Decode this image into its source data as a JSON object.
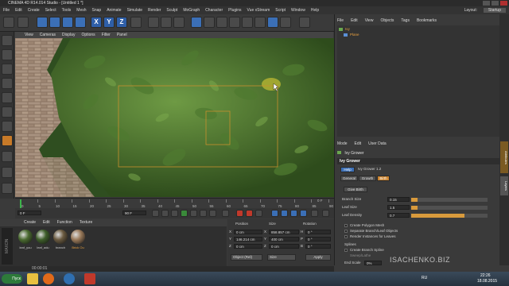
{
  "titlebar": {
    "title": "CINEMA 4D R14.014 Studio - [Untitled 1 *]"
  },
  "menubar": {
    "items": [
      "File",
      "Edit",
      "Create",
      "Select",
      "Tools",
      "Mesh",
      "Snap",
      "Animate",
      "Simulate",
      "Render",
      "Sculpt",
      "MoGraph",
      "Character",
      "Plugins",
      "Vue xStream",
      "Script",
      "Window",
      "Help"
    ],
    "layout_label": "Layout:",
    "layout_value": "Startup"
  },
  "toolbar": {
    "axis_letters": [
      "X",
      "Y",
      "Z"
    ]
  },
  "viewport": {
    "menu": [
      "View",
      "Cameras",
      "Display",
      "Options",
      "Filter",
      "Panel"
    ]
  },
  "timeline": {
    "ticks": [
      "0",
      "5",
      "10",
      "15",
      "20",
      "25",
      "30",
      "35",
      "40",
      "45",
      "50",
      "55",
      "60",
      "65",
      "70",
      "75",
      "80",
      "85",
      "90"
    ],
    "start_field": "0 F",
    "end_field": "90 F",
    "current_frame": "0 F"
  },
  "materials": {
    "menu": [
      "Create",
      "Edit",
      "Function",
      "Texture"
    ],
    "items": [
      {
        "label": "leaf_you",
        "color": "#4a6a30"
      },
      {
        "label": "leaf_adu",
        "color": "#3e5e2a"
      },
      {
        "label": "branch",
        "color": "#6a5a40"
      },
      {
        "label": "Brick Ou",
        "color": "#9a7a5a"
      }
    ]
  },
  "coordinates": {
    "headers": [
      "Position",
      "Size",
      "Rotation"
    ],
    "rows": [
      {
        "axis": "X",
        "pos": "0 cm",
        "size": "858.857 cm",
        "rot_axis": "H",
        "rot": "0 °"
      },
      {
        "axis": "Y",
        "pos": "146.214 cm",
        "size": "400 cm",
        "rot_axis": "P",
        "rot": "0 °"
      },
      {
        "axis": "Z",
        "pos": "0 cm",
        "size": "0 cm",
        "rot_axis": "B",
        "rot": "0 °"
      }
    ],
    "mode_select": "Object (Rel)",
    "size_select": "Size",
    "apply": "Apply"
  },
  "object_manager": {
    "menu": [
      "File",
      "Edit",
      "View",
      "Objects",
      "Tags",
      "Bookmarks"
    ],
    "objects": [
      "Ivy",
      "Plane"
    ]
  },
  "attributes": {
    "menu": [
      "Mode",
      "Edit",
      "User Data"
    ],
    "object_name": "Ivy Grower",
    "section_title": "Ivy Grower",
    "help": "Help",
    "version": "Ivy Grower 1.2",
    "tabs": [
      "General",
      "Growth",
      "Birth"
    ],
    "give_birth": "Give Birth",
    "params": [
      {
        "label": "Branch Size",
        "value": "0.15",
        "fill": 0.08
      },
      {
        "label": "Leaf Size",
        "value": "1.5",
        "fill": 0.08
      },
      {
        "label": "Leaf Density",
        "value": "0.7",
        "fill": 0.7
      }
    ],
    "checks": [
      "Create Polygon Mesh",
      "Separate Branch/Leaf Objects",
      "Render Instances for Leaves"
    ],
    "splines_label": "Splines",
    "spline_check": "Create Branch Spline",
    "spline_sub": "Sweep/Lathe",
    "end_scale_label": "End Scale",
    "end_scale_value": "0%"
  },
  "side_tabs": [
    "Attributes",
    "Layers"
  ],
  "status": {
    "time": "00:00:01"
  },
  "watermark": "ISACHENKO.BIZ",
  "taskbar": {
    "start": "Пуск",
    "lang": "RU",
    "clock_time": "22:26",
    "clock_date": "18.08.2015"
  }
}
